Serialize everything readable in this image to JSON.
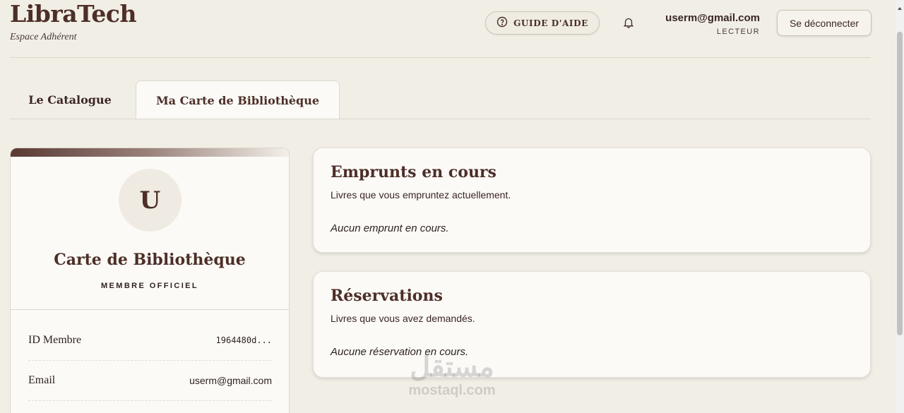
{
  "header": {
    "brand_title": "LibraTech",
    "brand_subtitle": "Espace Adhérent",
    "help_label": "GUIDE D'AIDE",
    "user_email": "userm@gmail.com",
    "user_role": "LECTEUR",
    "logout_label": "Se déconnecter",
    "icons": {
      "help": "help-circle-icon",
      "notifications": "bell-icon"
    }
  },
  "tabs": [
    {
      "label": "Le Catalogue",
      "active": false
    },
    {
      "label": "Ma Carte de Bibliothèque",
      "active": true
    }
  ],
  "member_card": {
    "avatar_initial": "U",
    "title": "Carte de Bibliothèque",
    "badge": "MEMBRE OFFICIEL",
    "rows": [
      {
        "label": "ID Membre",
        "value": "1964480d..."
      },
      {
        "label": "Email",
        "value": "userm@gmail.com"
      }
    ]
  },
  "loans": {
    "title": "Emprunts en cours",
    "subtitle": "Livres que vous empruntez actuellement.",
    "empty_text": "Aucun emprunt en cours."
  },
  "reservations": {
    "title": "Réservations",
    "subtitle": "Livres que vous avez demandés.",
    "empty_text": "Aucune réservation en cours."
  },
  "watermark": {
    "arabic": "مستقل",
    "latin": "mostaql.com"
  },
  "colors": {
    "accent": "#4d2f28",
    "background": "#f1eee6",
    "surface": "#fbfaf7"
  }
}
